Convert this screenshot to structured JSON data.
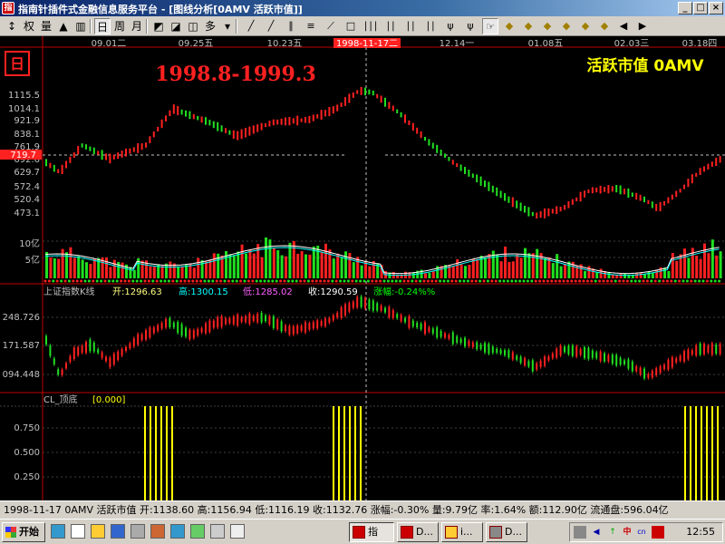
{
  "window": {
    "title": "指南针插件式金融信息服务平台 - [图线分析[0AMV 活跃市值]]",
    "controls": [
      "_",
      "□",
      "×"
    ]
  },
  "toolbar": {
    "items": [
      {
        "label": "↕",
        "icon": "cursor-icon"
      },
      {
        "label": "权",
        "icon": "weight-icon"
      },
      {
        "label": "量",
        "icon": "volume-icon"
      },
      {
        "label": "▲",
        "icon": "lock-icon"
      },
      {
        "label": "▥",
        "icon": "bars-icon"
      },
      {
        "label": "日",
        "icon": "day-icon"
      },
      {
        "label": "周",
        "icon": "week-icon"
      },
      {
        "label": "月",
        "icon": "month-icon"
      },
      {
        "label": "◩",
        "icon": "layout-icon"
      },
      {
        "label": "◪",
        "icon": "layout2-icon"
      },
      {
        "label": "◫",
        "icon": "layout3-icon"
      },
      {
        "label": "多",
        "icon": "multi-icon"
      },
      {
        "label": "▾",
        "icon": "dropdown-icon"
      }
    ],
    "tools": [
      "╱",
      "╱",
      "∥",
      "≡",
      "⟋",
      "□",
      "∣∣∣",
      "∣∣",
      "∣∣",
      "∣∣",
      "ψ",
      "ψ",
      "☞",
      "◆",
      "◆",
      "◆",
      "◆",
      "◆",
      "◆",
      "◀",
      "▶"
    ]
  },
  "chart": {
    "period_badge": "日",
    "annotation_title": "1998.8-1999.3",
    "indicator_name": "活跃市值 0AMV",
    "cursor_date": "1998-11-17二",
    "cursor_price": "719.7",
    "date_ticks": [
      "09.01二",
      "09.25五",
      "10.23五",
      "12.14一",
      "01.08五",
      "02.03三",
      "03.18四"
    ],
    "price_ticks": [
      "1115.5",
      "1014.1",
      "921.9",
      "838.1",
      "761.9",
      "692.6",
      "629.7",
      "572.4",
      "520.4",
      "473.1"
    ],
    "volume_ticks": [
      "10亿",
      "5亿"
    ],
    "sub_index": {
      "name": "上证指数K线",
      "open_label": "开:1296.63",
      "high_label": "高:1300.15",
      "low_label": "低:1285.02",
      "close_label": "收:1290.59",
      "change_label": "涨幅:-0.24%%",
      "ticks": [
        "248.726",
        "171.587",
        "094.448"
      ]
    },
    "cl": {
      "name": "CL_顶底",
      "value": "[0.000]",
      "ticks": [
        "0.750",
        "0.500",
        "0.250"
      ]
    },
    "colors": {
      "up": "#ff2020",
      "down": "#20e020",
      "ma1": "#ffffff",
      "ma2": "#ffff00",
      "ma3": "#00ffff",
      "axis": "#c00000",
      "signal": "#ffff00"
    }
  },
  "statusbar": {
    "text": "1998-11-17 0AMV 活跃市值 开:1138.60 高:1156.94 低:1116.19 收:1132.76 涨幅:-0.30% 量:9.79亿 率:1.64% 额:112.90亿 流通盘:596.04亿"
  },
  "taskbar": {
    "start_label": "开始",
    "quick_icons": [
      "ie-icon",
      "desktop-icon",
      "folder-icon",
      "word-icon",
      "pen-icon",
      "media-icon",
      "browser-icon",
      "app-icon",
      "calc-icon",
      "window-icon"
    ],
    "tasks": [
      "指",
      "D...",
      "i...",
      "D..."
    ],
    "tray_lang": "中",
    "tray_lang2": "cn",
    "clock": "12:55"
  }
}
